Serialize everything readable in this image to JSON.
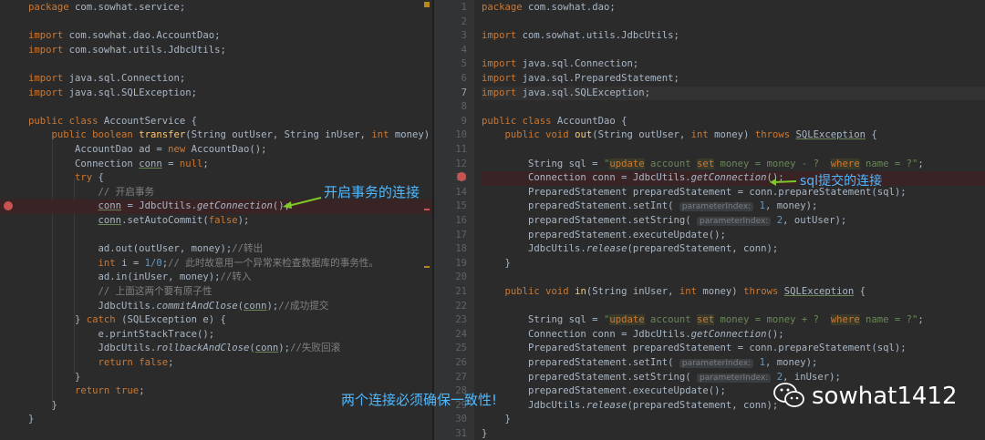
{
  "left": {
    "lines": [
      [
        [
          "k",
          "package "
        ],
        [
          "t",
          "com.sowhat.service;"
        ]
      ],
      [],
      [
        [
          "k",
          "import "
        ],
        [
          "t",
          "com.sowhat.dao.AccountDao;"
        ]
      ],
      [
        [
          "k",
          "import "
        ],
        [
          "t",
          "com.sowhat.utils.JdbcUtils;"
        ]
      ],
      [],
      [
        [
          "k",
          "import "
        ],
        [
          "t",
          "java.sql.Connection;"
        ]
      ],
      [
        [
          "k",
          "import "
        ],
        [
          "t",
          "java.sql.SQLException;"
        ]
      ],
      [],
      [
        [
          "k",
          "public class "
        ],
        [
          "t",
          "AccountService {"
        ]
      ],
      [
        [
          "t",
          "    "
        ],
        [
          "k",
          "public boolean "
        ],
        [
          "fn",
          "transfer"
        ],
        [
          "t",
          "(String outUser, String inUser, "
        ],
        [
          "k",
          "int "
        ],
        [
          "t",
          "money) {"
        ]
      ],
      [
        [
          "t",
          "        AccountDao ad = "
        ],
        [
          "k",
          "new "
        ],
        [
          "t",
          "AccountDao();"
        ]
      ],
      [
        [
          "t",
          "        Connection "
        ],
        [
          "u",
          "conn"
        ],
        [
          "t",
          " = "
        ],
        [
          "k",
          "null"
        ],
        [
          "t",
          ";"
        ]
      ],
      [
        [
          "t",
          "        "
        ],
        [
          "k",
          "try "
        ],
        [
          "t",
          "{"
        ]
      ],
      [
        [
          "t",
          "            "
        ],
        [
          "c",
          "// 开启事务"
        ]
      ],
      [
        [
          "t",
          "            "
        ],
        [
          "u",
          "conn"
        ],
        [
          "t",
          " = JdbcUtils."
        ],
        [
          "st",
          "getConnection"
        ],
        [
          "t",
          "();"
        ]
      ],
      [
        [
          "t",
          "            "
        ],
        [
          "u",
          "conn"
        ],
        [
          "t",
          ".setAutoCommit("
        ],
        [
          "k",
          "false"
        ],
        [
          "t",
          ");"
        ]
      ],
      [],
      [
        [
          "t",
          "            ad.out(outUser, money);"
        ],
        [
          "c",
          "//转出"
        ]
      ],
      [
        [
          "t",
          "            "
        ],
        [
          "k",
          "int "
        ],
        [
          "t",
          "i = "
        ],
        [
          "num",
          "1/0"
        ],
        [
          "t",
          ";"
        ],
        [
          "c",
          "// 此时故意用一个异常来检查数据库的事务性。"
        ]
      ],
      [
        [
          "t",
          "            ad.in(inUser, money);"
        ],
        [
          "c",
          "//转入"
        ]
      ],
      [
        [
          "t",
          "            "
        ],
        [
          "c",
          "// 上面这两个要有原子性"
        ]
      ],
      [
        [
          "t",
          "            JdbcUtils."
        ],
        [
          "st",
          "commitAndClose"
        ],
        [
          "t",
          "("
        ],
        [
          "u",
          "conn"
        ],
        [
          "t",
          ");"
        ],
        [
          "c",
          "//成功提交"
        ]
      ],
      [
        [
          "t",
          "        } "
        ],
        [
          "k",
          "catch "
        ],
        [
          "t",
          "(SQLException e) {"
        ]
      ],
      [
        [
          "t",
          "            e.printStackTrace();"
        ]
      ],
      [
        [
          "t",
          "            JdbcUtils."
        ],
        [
          "st",
          "rollbackAndClose"
        ],
        [
          "t",
          "("
        ],
        [
          "u",
          "conn"
        ],
        [
          "t",
          ");"
        ],
        [
          "c",
          "//失败回滚"
        ]
      ],
      [
        [
          "t",
          "            "
        ],
        [
          "k",
          "return false"
        ],
        [
          "t",
          ";"
        ]
      ],
      [
        [
          "t",
          "        }"
        ]
      ],
      [
        [
          "t",
          "        "
        ],
        [
          "k",
          "return true"
        ],
        [
          "t",
          ";"
        ]
      ],
      [
        [
          "t",
          "    }"
        ]
      ],
      [
        [
          "t",
          "}"
        ]
      ]
    ]
  },
  "right": {
    "line_numbers": [
      "1",
      "2",
      "3",
      "4",
      "5",
      "6",
      "7",
      "8",
      "9",
      "10",
      "11",
      "12",
      "13",
      "14",
      "15",
      "16",
      "17",
      "18",
      "19",
      "20",
      "21",
      "22",
      "23",
      "24",
      "25",
      "26",
      "27",
      "28",
      "29",
      "30",
      "31"
    ],
    "lines": [
      [
        [
          "k",
          "package "
        ],
        [
          "t",
          "com.sowhat.dao;"
        ]
      ],
      [],
      [
        [
          "k",
          "import "
        ],
        [
          "t",
          "com.sowhat.utils.JdbcUtils;"
        ]
      ],
      [],
      [
        [
          "k",
          "import "
        ],
        [
          "t",
          "java.sql.Connection;"
        ]
      ],
      [
        [
          "k",
          "import "
        ],
        [
          "t",
          "java.sql.PreparedStatement;"
        ]
      ],
      [
        [
          "k",
          "import "
        ],
        [
          "t",
          "java.sql.SQLException;"
        ]
      ],
      [],
      [
        [
          "k",
          "public class "
        ],
        [
          "t",
          "AccountDao {"
        ]
      ],
      [
        [
          "t",
          "    "
        ],
        [
          "k",
          "public void "
        ],
        [
          "fn",
          "out"
        ],
        [
          "t",
          "(String outUser, "
        ],
        [
          "k",
          "int "
        ],
        [
          "t",
          "money) "
        ],
        [
          "k",
          "throws "
        ],
        [
          "u",
          "SQLException"
        ],
        [
          "t",
          " {"
        ]
      ],
      [],
      [
        [
          "t",
          "        String sql = "
        ],
        [
          "s",
          "\""
        ],
        [
          "sk",
          "update"
        ],
        [
          "s",
          " account "
        ],
        [
          "sk",
          "set"
        ],
        [
          "s",
          " money = money - ?  "
        ],
        [
          "sk",
          "where"
        ],
        [
          "s",
          " name = ?\""
        ],
        [
          "t",
          ";"
        ]
      ],
      [
        [
          "t",
          "        Connection conn = JdbcUtils."
        ],
        [
          "st",
          "getConnection"
        ],
        [
          "t",
          "();"
        ]
      ],
      [
        [
          "t",
          "        PreparedStatement preparedStatement = conn.prepareStatement(sql);"
        ]
      ],
      [
        [
          "t",
          "        preparedStatement.setInt( "
        ],
        [
          "h",
          "parameterIndex:"
        ],
        [
          "t",
          " "
        ],
        [
          "num",
          "1"
        ],
        [
          "t",
          ", money);"
        ]
      ],
      [
        [
          "t",
          "        preparedStatement.setString( "
        ],
        [
          "h",
          "parameterIndex:"
        ],
        [
          "t",
          " "
        ],
        [
          "num",
          "2"
        ],
        [
          "t",
          ", outUser);"
        ]
      ],
      [
        [
          "t",
          "        preparedStatement.executeUpdate();"
        ]
      ],
      [
        [
          "t",
          "        JdbcUtils."
        ],
        [
          "st",
          "release"
        ],
        [
          "t",
          "(preparedStatement, conn);"
        ]
      ],
      [
        [
          "t",
          "    }"
        ]
      ],
      [],
      [
        [
          "t",
          "    "
        ],
        [
          "k",
          "public void "
        ],
        [
          "fn",
          "in"
        ],
        [
          "t",
          "(String inUser, "
        ],
        [
          "k",
          "int "
        ],
        [
          "t",
          "money) "
        ],
        [
          "k",
          "throws "
        ],
        [
          "u",
          "SQLException"
        ],
        [
          "t",
          " {"
        ]
      ],
      [],
      [
        [
          "t",
          "        String sql = "
        ],
        [
          "s",
          "\""
        ],
        [
          "sk",
          "update"
        ],
        [
          "s",
          " account "
        ],
        [
          "sk",
          "set"
        ],
        [
          "s",
          " money = money + ?  "
        ],
        [
          "sk",
          "where"
        ],
        [
          "s",
          " name = ?\""
        ],
        [
          "t",
          ";"
        ]
      ],
      [
        [
          "t",
          "        Connection conn = JdbcUtils."
        ],
        [
          "st",
          "getConnection"
        ],
        [
          "t",
          "();"
        ]
      ],
      [
        [
          "t",
          "        PreparedStatement preparedStatement = conn.prepareStatement(sql);"
        ]
      ],
      [
        [
          "t",
          "        preparedStatement.setInt( "
        ],
        [
          "h",
          "parameterIndex:"
        ],
        [
          "t",
          " "
        ],
        [
          "num",
          "1"
        ],
        [
          "t",
          ", money);"
        ]
      ],
      [
        [
          "t",
          "        preparedStatement.setString( "
        ],
        [
          "h",
          "parameterIndex:"
        ],
        [
          "t",
          " "
        ],
        [
          "num",
          "2"
        ],
        [
          "t",
          ", inUser);"
        ]
      ],
      [
        [
          "t",
          "        preparedStatement.executeUpdate();"
        ]
      ],
      [
        [
          "t",
          "        JdbcUtils."
        ],
        [
          "st",
          "release"
        ],
        [
          "t",
          "(preparedStatement, conn);"
        ]
      ],
      [
        [
          "t",
          "    }"
        ]
      ],
      [
        [
          "t",
          "}"
        ]
      ]
    ]
  },
  "annotations": {
    "open_tx": "开启事务的连接",
    "sql_conn": "sql提交的连接",
    "consistency": "两个连接必须确保一致性!"
  },
  "watermark": {
    "text": "sowhat1412",
    "icon": "wechat-icon"
  },
  "colors": {
    "keyword": "#cc7832",
    "string": "#6a8759",
    "comment": "#808080",
    "function": "#ffc66d",
    "annotation": "#4fb8ff",
    "breakpoint": "#c75450"
  }
}
